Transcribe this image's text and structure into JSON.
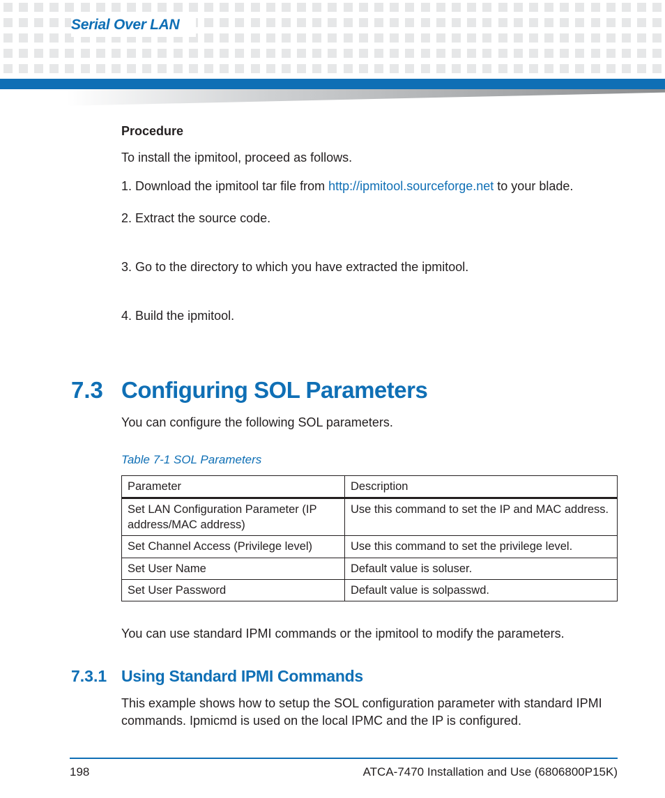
{
  "header": {
    "section_title": "Serial Over LAN"
  },
  "procedure": {
    "title": "Procedure",
    "intro": "To install the ipmitool, proceed as follows.",
    "steps": [
      {
        "pre": "Download the ipmitool tar file from ",
        "link_text": "http://ipmitool.sourceforge.net",
        "post": " to your blade."
      },
      {
        "pre": "Extract the source code.",
        "link_text": "",
        "post": ""
      },
      {
        "pre": "Go to the directory to which you have extracted the ipmitool.",
        "link_text": "",
        "post": ""
      },
      {
        "pre": "Build the ipmitool.",
        "link_text": "",
        "post": ""
      }
    ]
  },
  "section73": {
    "num": "7.3",
    "title": "Configuring SOL Parameters",
    "intro": "You can configure the following SOL parameters.",
    "table_caption": "Table 7-1 SOL Parameters",
    "table": {
      "headers": [
        "Parameter",
        "Description"
      ],
      "rows": [
        [
          "Set LAN Configuration Parameter (IP address/MAC address)",
          "Use this command to set the IP and MAC address."
        ],
        [
          "Set Channel Access (Privilege level)",
          "Use this command to set the privilege level."
        ],
        [
          "Set User Name",
          "Default value is soluser."
        ],
        [
          "Set User Password",
          "Default value is solpasswd."
        ]
      ]
    },
    "after_table": "You can use standard IPMI commands or the ipmitool to modify the parameters."
  },
  "section731": {
    "num": "7.3.1",
    "title": "Using Standard IPMI Commands",
    "body": "This example shows how to setup the SOL configuration parameter with standard IPMI commands. Ipmicmd is used on the local IPMC and the IP is configured."
  },
  "footer": {
    "page": "198",
    "doc": "ATCA-7470 Installation and Use (6806800P15K)"
  }
}
